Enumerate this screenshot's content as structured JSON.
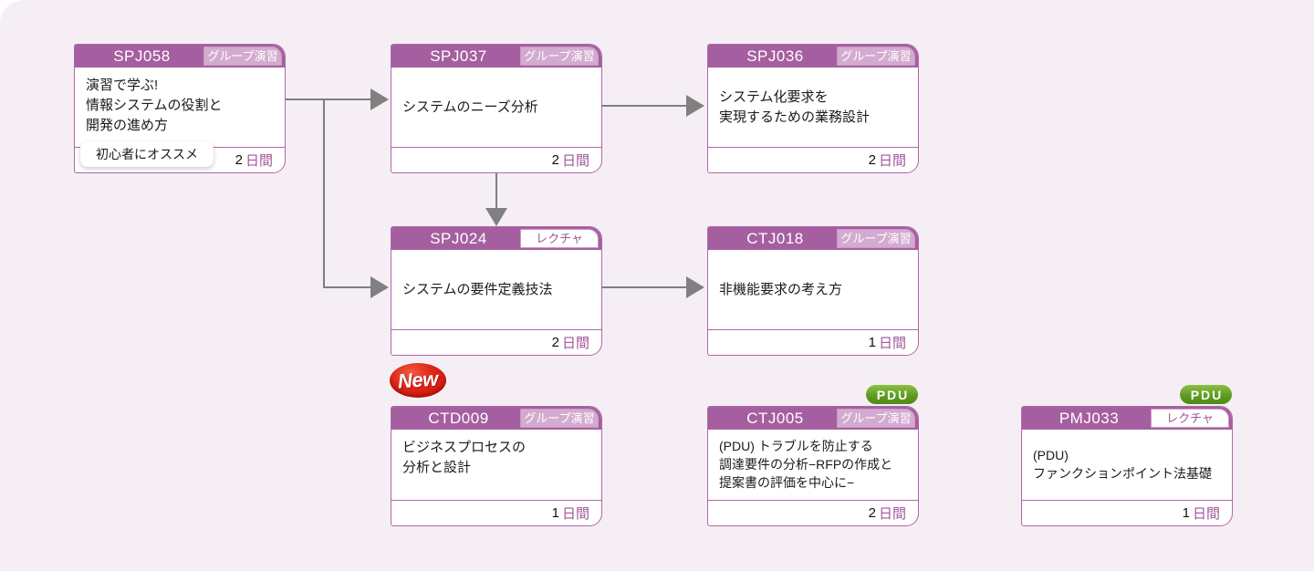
{
  "page": {
    "background_color": "#f5eff5",
    "accent_color": "#a55fa0",
    "line_color": "#808080"
  },
  "labels": {
    "group_exercise": "グループ演習",
    "lecture": "レクチャ",
    "unit": "日間",
    "recommend": "初心者にオススメ",
    "new": "New",
    "pdu_p": "P",
    "pdu_d": "D",
    "pdu_u": "U"
  },
  "cards": [
    {
      "code": "SPJ058",
      "badge": "グループ演習",
      "badge_type": "group",
      "title": "演習で学ぶ!\n情報システムの役割と\n開発の進め方",
      "days": "2",
      "unit": "日間",
      "recommend": "初心者にオススメ",
      "new": false,
      "pdu": false
    },
    {
      "code": "SPJ037",
      "badge": "グループ演習",
      "badge_type": "group",
      "title": "システムのニーズ分析",
      "days": "2",
      "unit": "日間",
      "new": false,
      "pdu": false
    },
    {
      "code": "SPJ036",
      "badge": "グループ演習",
      "badge_type": "group",
      "title": "システム化要求を\n実現するための業務設計",
      "days": "2",
      "unit": "日間",
      "new": false,
      "pdu": false
    },
    {
      "code": "SPJ024",
      "badge": "レクチャ",
      "badge_type": "lecture",
      "title": "システムの要件定義技法",
      "days": "2",
      "unit": "日間",
      "new": false,
      "pdu": false
    },
    {
      "code": "CTJ018",
      "badge": "グループ演習",
      "badge_type": "group",
      "title": "非機能要求の考え方",
      "days": "1",
      "unit": "日間",
      "new": false,
      "pdu": false
    },
    {
      "code": "CTD009",
      "badge": "グループ演習",
      "badge_type": "group",
      "title": "ビジネスプロセスの\n分析と設計",
      "days": "1",
      "unit": "日間",
      "new": true,
      "pdu": false
    },
    {
      "code": "CTJ005",
      "badge": "グループ演習",
      "badge_type": "group",
      "title": "(PDU) トラブルを防止する\n調達要件の分析−RFPの作成と\n提案書の評価を中心に−",
      "days": "2",
      "unit": "日間",
      "new": false,
      "pdu": true
    },
    {
      "code": "PMJ033",
      "badge": "レクチャ",
      "badge_type": "lecture",
      "title": "(PDU)\nファンクションポイント法基礎",
      "days": "1",
      "unit": "日間",
      "new": false,
      "pdu": true
    }
  ],
  "connections": [
    {
      "from": "SPJ058",
      "to": "SPJ037"
    },
    {
      "from": "SPJ058",
      "to": "SPJ024"
    },
    {
      "from": "SPJ037",
      "to": "SPJ036"
    },
    {
      "from": "SPJ037",
      "to": "SPJ024"
    },
    {
      "from": "SPJ024",
      "to": "CTJ018"
    }
  ]
}
